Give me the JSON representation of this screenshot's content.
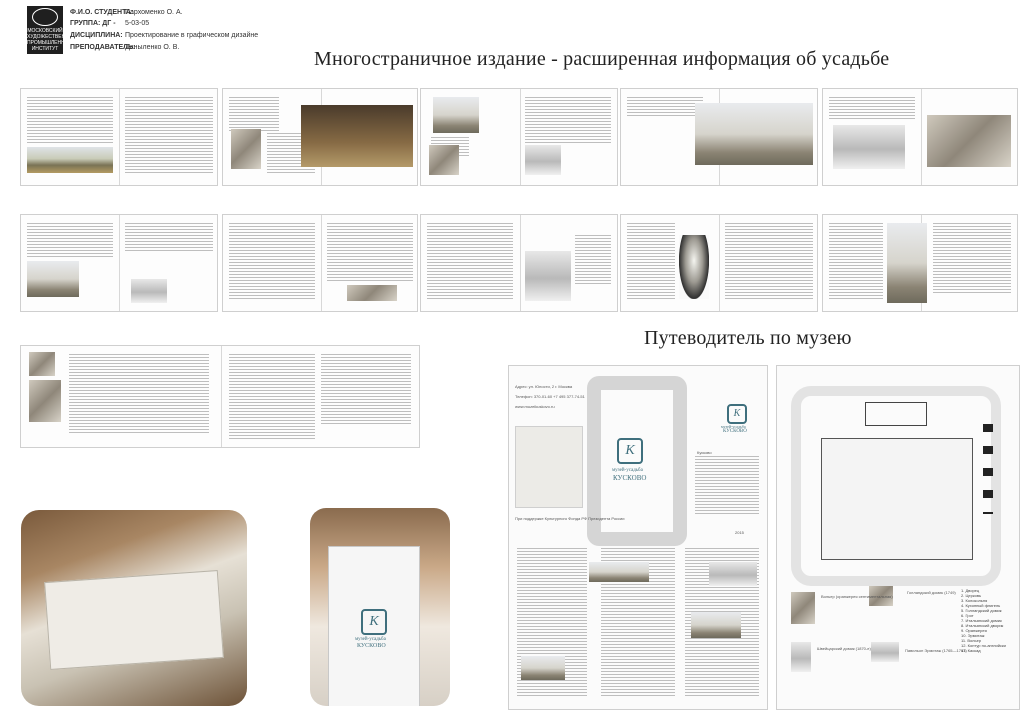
{
  "header": {
    "student_label": "Ф.И.О. СТУДЕНТА:",
    "student_value": "Пархоменко О. А.",
    "group_label": "ГРУППА: ДГ -",
    "group_value": "5-03-05",
    "discipline_label": "ДИСЦИПЛИНА:",
    "discipline_value": "Проектирование в графическом дизайне",
    "teacher_label": "ПРЕПОДАВАТЕЛЬ:",
    "teacher_value": "Даныленко О. В.",
    "logo_text": "МОСКОВСКИЙ ХУДОЖЕСТВЕННО ПРОМЫШЛЕННЫЙ ИНСТИТУТ"
  },
  "titles": {
    "multipage": "Многостраничное издание - расширенная информация об усадьбе",
    "guide": "Путеводитель по музею"
  },
  "brochure": {
    "logo_letter": "К",
    "museum_small": "музей-усадьба",
    "museum_name": "КУСКОВО",
    "address": "Адрес: ул. Юности, 2 г. Москва",
    "phone": "Телефон: 370-01-60 +7 495 377-74-51",
    "site": "www.muzeikuskovo.ru",
    "year": "2015",
    "right_heading": "Кусково",
    "sign_note": "При поддержке Культурного Фонда РФ Президента России"
  },
  "map_legend": {
    "items": [
      "1. Дворец",
      "2. Церковь",
      "3. Колокольня",
      "4. Кухонный флигель",
      "5. Голландский домик",
      "6. Грот",
      "7. Итальянский домик",
      "8. Итальянский дворик",
      "9. Оранжерея",
      "10. Эрмитаж",
      "11. Вольер",
      "12. Контур по-английски",
      "13. Каскад"
    ],
    "captions": [
      "Вольер (оранжерея сентиментальная)",
      "Голландский домик (1749)",
      "Швейцарский домик (1870-е)",
      "Павильон Эрмитаж (1765—1767)"
    ]
  }
}
